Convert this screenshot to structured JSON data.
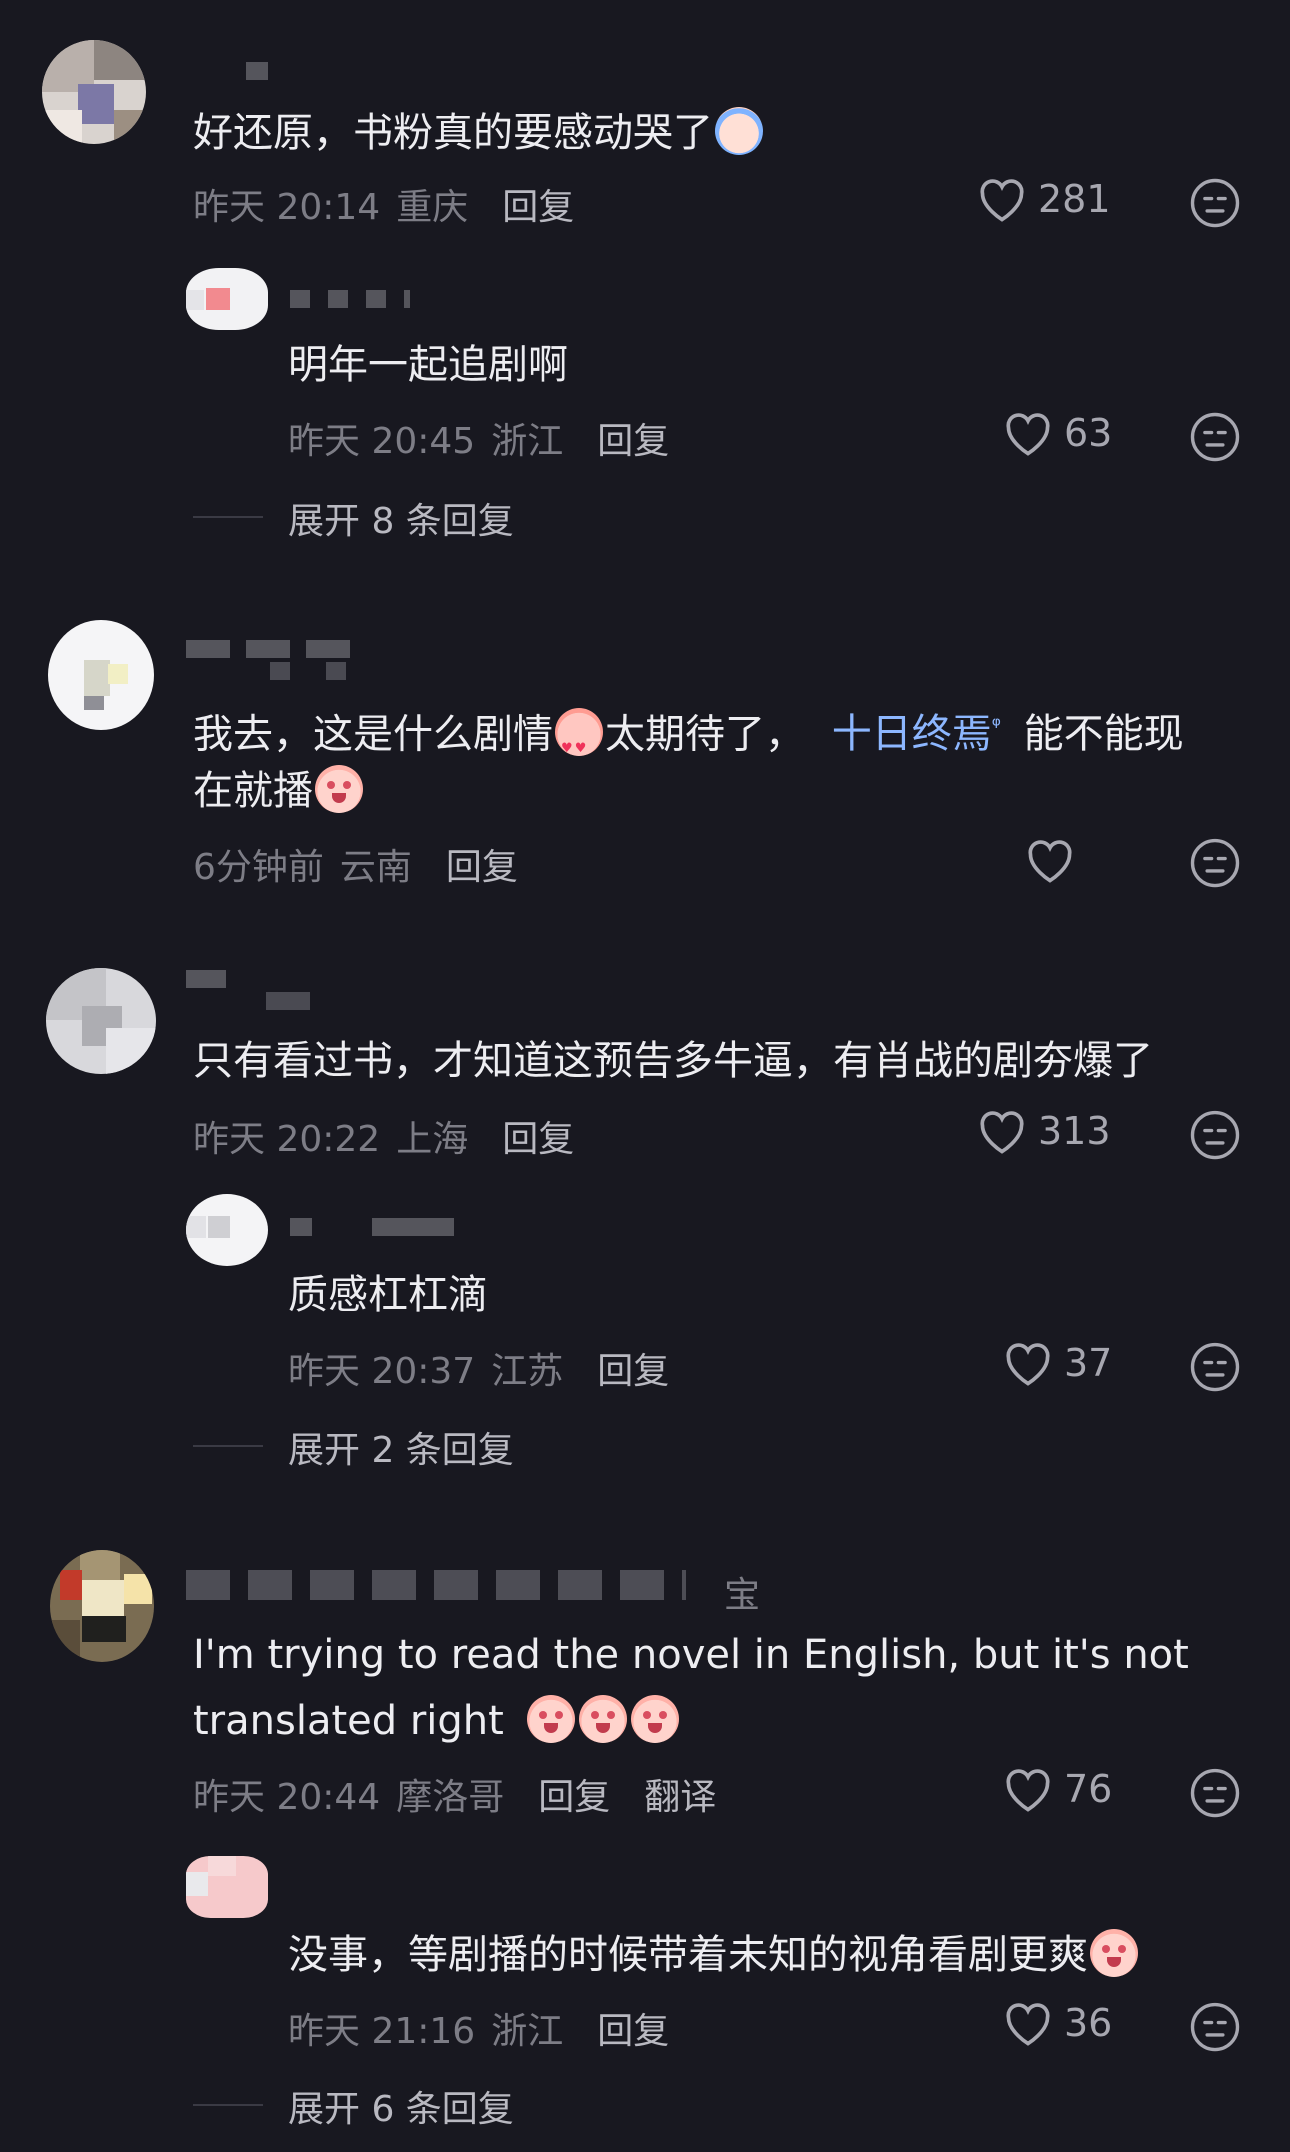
{
  "comments": [
    {
      "text": "好还原，书粉真的要感动哭了",
      "emoji": "crying-emoji",
      "time": "昨天 20:14",
      "location": "重庆",
      "reply_label": "回复",
      "likes": "281",
      "replies": [
        {
          "text": "明年一起追剧啊",
          "time": "昨天 20:45",
          "location": "浙江",
          "reply_label": "回复",
          "likes": "63"
        }
      ],
      "expand_label": "展开 8 条回复"
    },
    {
      "text_before_link": "我去，这是什么剧情",
      "text_mid": "太期待了，",
      "link": "十日终焉",
      "link_icon": "search-icon",
      "text_after_link": "能不能现",
      "text_line2": "在就播",
      "time": "6分钟前",
      "location": "云南",
      "reply_label": "回复",
      "likes": ""
    },
    {
      "text": "只有看过书，才知道这预告多牛逼，有肖战的剧夯爆了",
      "time": "昨天 20:22",
      "location": "上海",
      "reply_label": "回复",
      "likes": "313",
      "replies": [
        {
          "text": "质感杠杠滴",
          "time": "昨天 20:37",
          "location": "江苏",
          "reply_label": "回复",
          "likes": "37"
        }
      ],
      "expand_label": "展开 2 条回复"
    },
    {
      "username_tail": "宝",
      "text_line1": "I'm trying to read the novel in English, but it's not",
      "text_line2": "translated right",
      "time": "昨天 20:44",
      "location": "摩洛哥",
      "reply_label": "回复",
      "translate_label": "翻译",
      "likes": "76",
      "replies": [
        {
          "text": "没事，等剧播的时候带着未知的视角看剧更爽",
          "time": "昨天 21:16",
          "location": "浙江",
          "reply_label": "回复",
          "likes": "36"
        }
      ],
      "expand_label": "展开 6 条回复"
    }
  ],
  "colors": {
    "background": "#181820",
    "text": "#ededf1",
    "meta": "#7d7d86",
    "link": "#8db7ff"
  }
}
